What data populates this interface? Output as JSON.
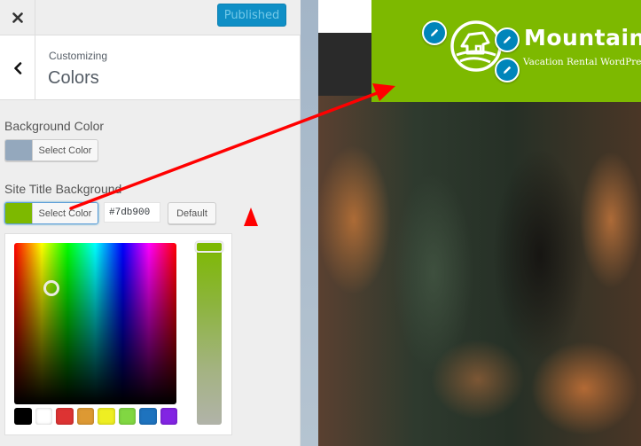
{
  "topbar": {
    "close_icon": "close-icon",
    "publish_label": "Published"
  },
  "section": {
    "back_icon": "chevron-left-icon",
    "breadcrumb": "Customizing",
    "title": "Colors"
  },
  "controls": {
    "background_color": {
      "label": "Background Color",
      "button_label": "Select Color",
      "swatch_color": "#94a8bd"
    },
    "site_title_background": {
      "label": "Site Title Background",
      "button_label": "Select Color",
      "swatch_color": "#7db900",
      "hex_value": "#7db900",
      "default_label": "Default"
    }
  },
  "picker": {
    "current_color": "#7db900",
    "palette": [
      "#000000",
      "#ffffff",
      "#dd3333",
      "#dd9933",
      "#eeee22",
      "#81d742",
      "#1e73be",
      "#8224e3"
    ]
  },
  "preview": {
    "header_color": "#7db900",
    "site_title": "Mountainv",
    "site_tagline": "Vacation Rental WordPress",
    "edit_icon": "pencil-icon",
    "logo_icon": "house-logo-icon"
  },
  "annotation": {
    "arrow_color": "#ff0000",
    "marker_color": "#ff0000"
  }
}
